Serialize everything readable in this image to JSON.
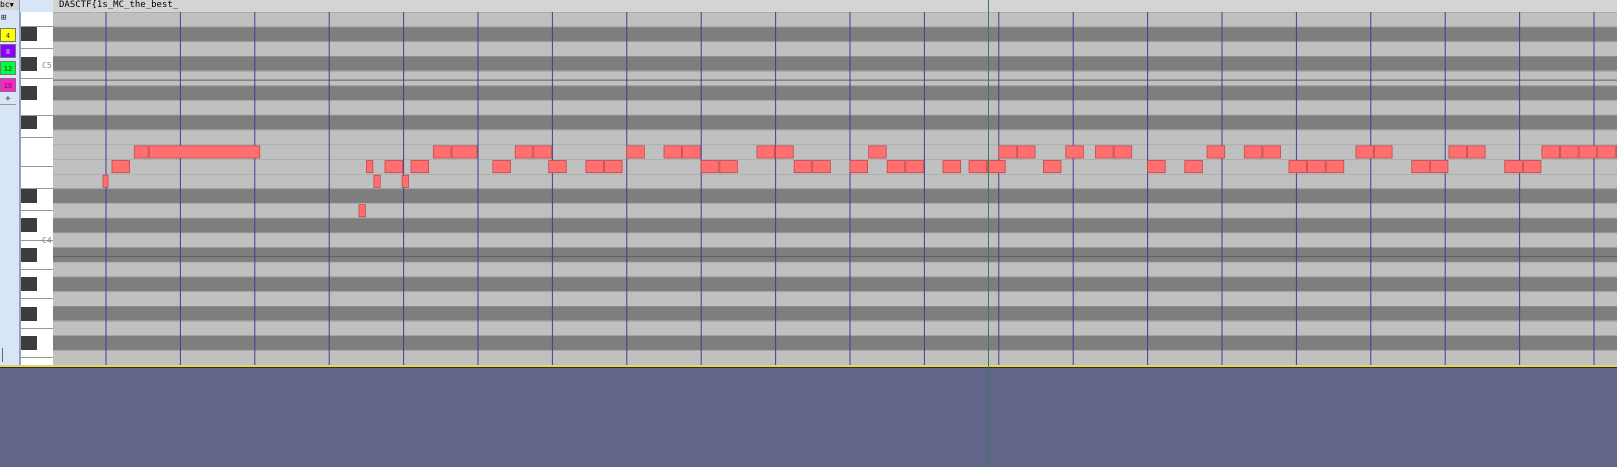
{
  "app": {
    "track_title": "DASCTF{1s_MC_the_best_",
    "header_label": "bc",
    "grid_icon_label": "⊞",
    "add_icon_label": "+"
  },
  "quantize_buttons": [
    {
      "label": "4",
      "color": "#ffff00",
      "text_color": "#333333"
    },
    {
      "label": "8",
      "color": "#8a00ff",
      "text_color": "#dddddd"
    },
    {
      "label": "12",
      "color": "#00ff3c",
      "text_color": "#333333"
    },
    {
      "label": "16",
      "color": "#ff22cc",
      "text_color": "#333333"
    }
  ],
  "keyboard": {
    "octave_labels": [
      "C5",
      "C4"
    ]
  },
  "colors": {
    "note": "#ff6f6f",
    "note_border": "#c24a4a",
    "row_dark": "#7e7e7e",
    "row_light": "#c0c0c0",
    "beat_line": "#3a3f9a",
    "playhead": "#2f7f4f"
  },
  "playhead_beat": 11.85,
  "notes": [
    {
      "row": 11,
      "start": -0.04,
      "len": 0.08
    },
    {
      "row": 10,
      "start": 0.08,
      "len": 0.25
    },
    {
      "row": 9,
      "start": 0.38,
      "len": 0.2
    },
    {
      "row": 9,
      "start": 0.58,
      "len": 1.5
    },
    {
      "row": 13,
      "start": 3.4,
      "len": 0.1
    },
    {
      "row": 10,
      "start": 3.5,
      "len": 0.1
    },
    {
      "row": 11,
      "start": 3.6,
      "len": 0.1
    },
    {
      "row": 10,
      "start": 3.75,
      "len": 0.25
    },
    {
      "row": 11,
      "start": 3.98,
      "len": 0.1
    },
    {
      "row": 10,
      "start": 4.1,
      "len": 0.25
    },
    {
      "row": 9,
      "start": 4.4,
      "len": 0.25
    },
    {
      "row": 9,
      "start": 4.65,
      "len": 0.35
    },
    {
      "row": 10,
      "start": 5.2,
      "len": 0.25
    },
    {
      "row": 9,
      "start": 5.5,
      "len": 0.25
    },
    {
      "row": 9,
      "start": 5.75,
      "len": 0.25
    },
    {
      "row": 10,
      "start": 5.95,
      "len": 0.25
    },
    {
      "row": 10,
      "start": 6.45,
      "len": 0.25
    },
    {
      "row": 10,
      "start": 6.7,
      "len": 0.25
    },
    {
      "row": 9,
      "start": 7.0,
      "len": 0.25
    },
    {
      "row": 9,
      "start": 7.5,
      "len": 0.25
    },
    {
      "row": 9,
      "start": 7.75,
      "len": 0.25
    },
    {
      "row": 10,
      "start": 8.0,
      "len": 0.25
    },
    {
      "row": 10,
      "start": 8.25,
      "len": 0.25
    },
    {
      "row": 9,
      "start": 8.75,
      "len": 0.25
    },
    {
      "row": 9,
      "start": 9.0,
      "len": 0.25
    },
    {
      "row": 10,
      "start": 9.25,
      "len": 0.25
    },
    {
      "row": 10,
      "start": 9.5,
      "len": 0.25
    },
    {
      "row": 10,
      "start": 10.0,
      "len": 0.25
    },
    {
      "row": 9,
      "start": 10.25,
      "len": 0.25
    },
    {
      "row": 10,
      "start": 10.5,
      "len": 0.25
    },
    {
      "row": 10,
      "start": 10.75,
      "len": 0.25
    },
    {
      "row": 10,
      "start": 11.25,
      "len": 0.25
    },
    {
      "row": 10,
      "start": 11.6,
      "len": 0.25
    },
    {
      "row": 10,
      "start": 11.85,
      "len": 0.25
    },
    {
      "row": 9,
      "start": 12.0,
      "len": 0.25
    },
    {
      "row": 9,
      "start": 12.25,
      "len": 0.25
    },
    {
      "row": 10,
      "start": 12.6,
      "len": 0.25
    },
    {
      "row": 9,
      "start": 12.9,
      "len": 0.25
    },
    {
      "row": 9,
      "start": 13.3,
      "len": 0.25
    },
    {
      "row": 9,
      "start": 13.55,
      "len": 0.25
    },
    {
      "row": 10,
      "start": 14.0,
      "len": 0.25
    },
    {
      "row": 10,
      "start": 14.5,
      "len": 0.25
    },
    {
      "row": 9,
      "start": 14.8,
      "len": 0.25
    },
    {
      "row": 9,
      "start": 15.3,
      "len": 0.25
    },
    {
      "row": 9,
      "start": 15.55,
      "len": 0.25
    },
    {
      "row": 10,
      "start": 15.9,
      "len": 0.25
    },
    {
      "row": 10,
      "start": 16.15,
      "len": 0.25
    },
    {
      "row": 10,
      "start": 16.4,
      "len": 0.25
    },
    {
      "row": 9,
      "start": 16.8,
      "len": 0.25
    },
    {
      "row": 9,
      "start": 17.05,
      "len": 0.25
    },
    {
      "row": 10,
      "start": 17.55,
      "len": 0.25
    },
    {
      "row": 10,
      "start": 17.8,
      "len": 0.25
    },
    {
      "row": 9,
      "start": 18.05,
      "len": 0.25
    },
    {
      "row": 9,
      "start": 18.3,
      "len": 0.25
    },
    {
      "row": 10,
      "start": 18.8,
      "len": 0.25
    },
    {
      "row": 10,
      "start": 19.05,
      "len": 0.25
    },
    {
      "row": 9,
      "start": 19.3,
      "len": 0.25
    },
    {
      "row": 9,
      "start": 19.55,
      "len": 0.25
    },
    {
      "row": 9,
      "start": 19.8,
      "len": 0.25
    },
    {
      "row": 9,
      "start": 20.05,
      "len": 0.25
    },
    {
      "row": 9,
      "start": 20.3,
      "len": 0.25
    },
    {
      "row": 10,
      "start": 20.55,
      "len": 0.25
    },
    {
      "row": 9,
      "start": 20.85,
      "len": 0.25
    }
  ]
}
